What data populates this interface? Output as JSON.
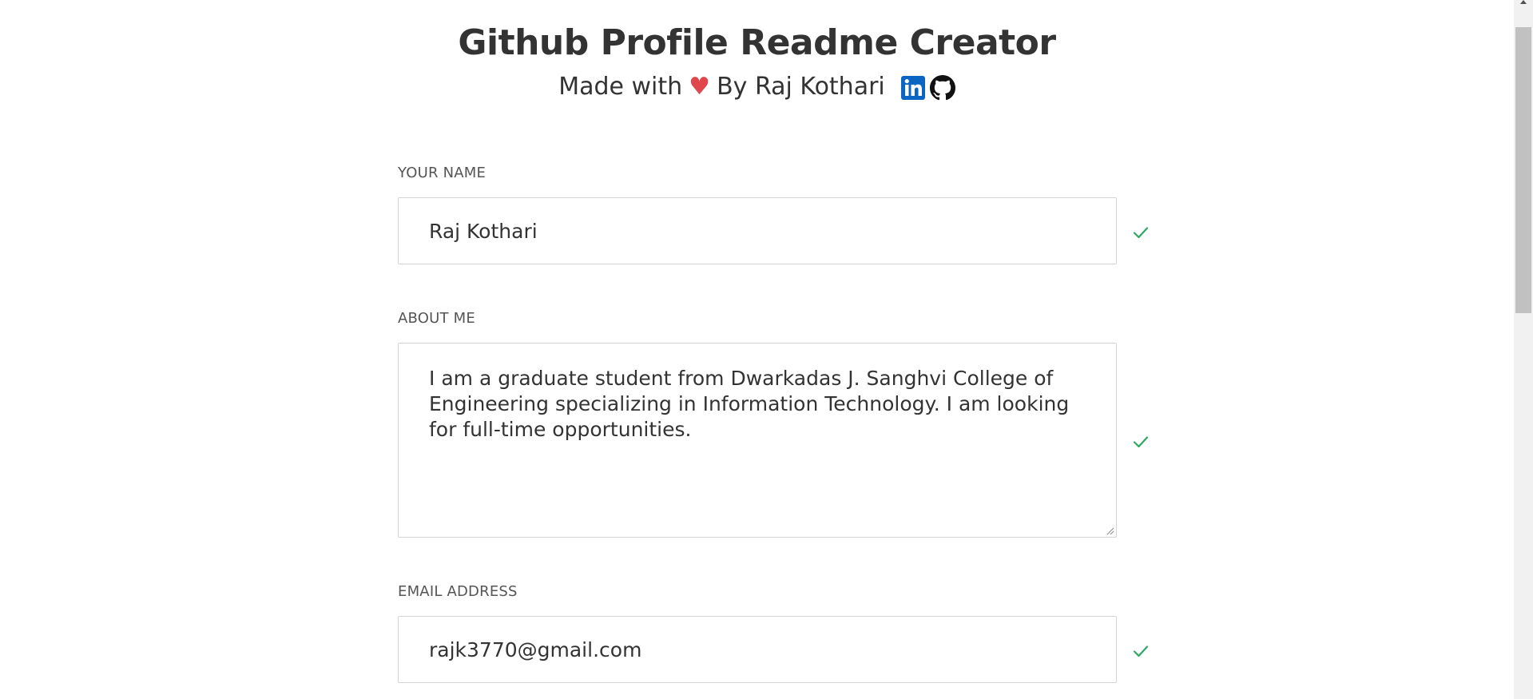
{
  "header": {
    "title": "Github Profile Readme Creator",
    "made_with": "Made with",
    "heart": "♥",
    "by_text": "By Raj Kothari",
    "linkedin_icon": "linkedin-icon",
    "github_icon": "github-icon"
  },
  "form": {
    "name": {
      "label": "YOUR NAME",
      "value": "Raj Kothari"
    },
    "about": {
      "label": "ABOUT ME",
      "value": "I am a graduate student from Dwarkadas J. Sanghvi College of Engineering specializing in Information Technology. I am looking for full-time opportunities."
    },
    "email": {
      "label": "EMAIL ADDRESS",
      "value": "rajk3770@gmail.com"
    }
  },
  "colors": {
    "heart": "#e0474c",
    "check": "#2fa866",
    "linkedin": "#0a66c2",
    "text": "#333333"
  }
}
